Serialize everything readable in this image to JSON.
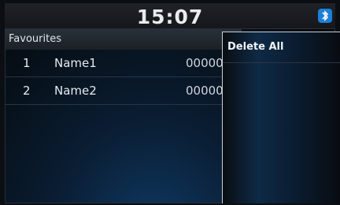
{
  "status_bar": {
    "time": "15:07",
    "bluetooth_icon": "bluetooth-icon"
  },
  "favourites": {
    "title": "Favourites",
    "items": [
      {
        "index": "1",
        "name": "Name1",
        "number": "00000"
      },
      {
        "index": "2",
        "name": "Name2",
        "number": "00000"
      }
    ]
  },
  "menu": {
    "items": [
      {
        "label": "Delete All"
      }
    ]
  },
  "colors": {
    "background": "#0b0e12",
    "accent_blue": "#0f3a64",
    "text": "#e6ebf0"
  }
}
